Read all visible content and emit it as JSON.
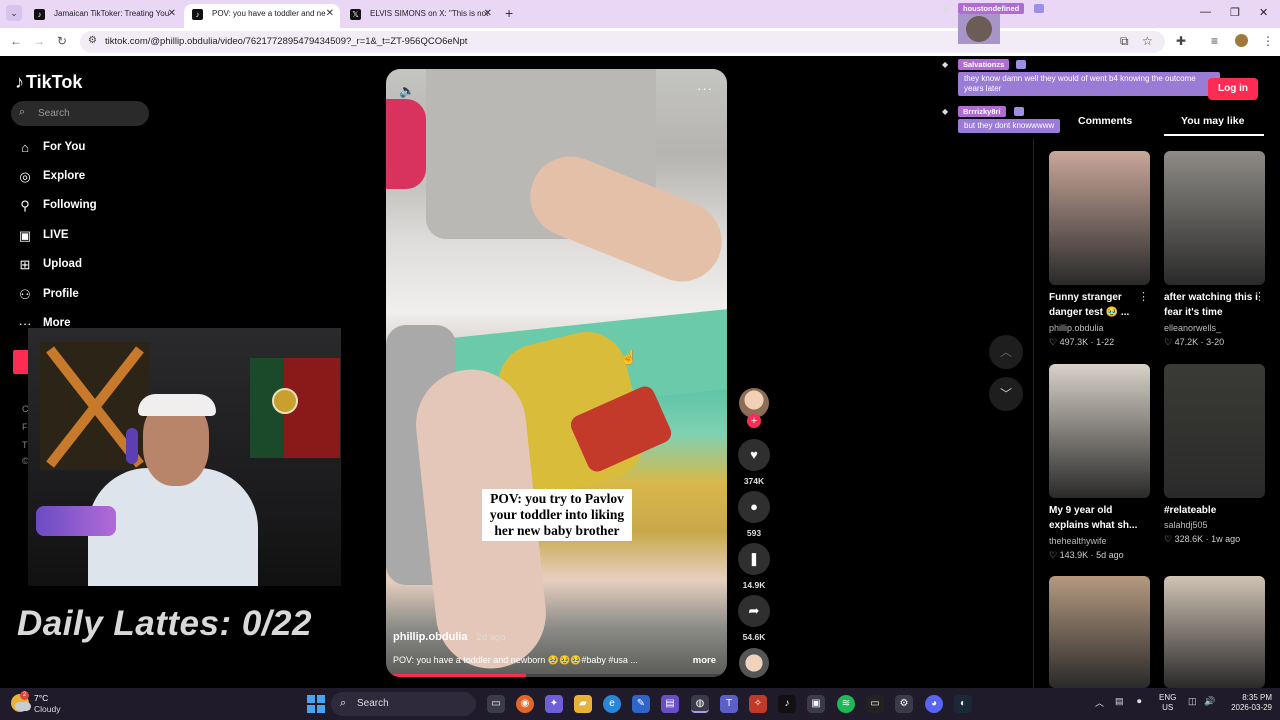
{
  "browser": {
    "tabs": [
      {
        "label": "Jamaican TikToker: Treating You",
        "favicon": "tiktok-icon"
      },
      {
        "label": "POV: you have a toddler and ne",
        "favicon": "tiktok-icon"
      },
      {
        "label": "ELVIS SIMONS on X: \"This is not",
        "favicon": "x-icon"
      }
    ],
    "url": "tiktok.com/@phillip.obdulia/video/7621772895479434509?_r=1&_t=ZT-956QCO6eNpt"
  },
  "tiktok": {
    "logo": "TikTok",
    "search_placeholder": "Search",
    "nav": [
      {
        "label": "For You",
        "icon": "home-icon"
      },
      {
        "label": "Explore",
        "icon": "compass-icon"
      },
      {
        "label": "Following",
        "icon": "user-icon"
      },
      {
        "label": "LIVE",
        "icon": "live-icon"
      },
      {
        "label": "Upload",
        "icon": "plus-square-icon"
      },
      {
        "label": "Profile",
        "icon": "profile-icon"
      },
      {
        "label": "More",
        "icon": "more-icon"
      }
    ],
    "login_label": "Log in",
    "side_tabs": {
      "comments": "Comments",
      "you_may_like": "You may like"
    },
    "video": {
      "caption": "POV: you try to Pavlov your toddler into liking her new baby brother",
      "author": "phillip.obdulia",
      "posted": "· 2d ago",
      "description": "POV: you have a toddler and newborn 🥹🥹🥹#baby #usa ...",
      "more_label": "more",
      "progress": 0.41
    },
    "actions": {
      "likes": "374K",
      "comments": "593",
      "saves": "14.9K",
      "shares": "54.6K"
    },
    "recommendations": [
      {
        "title": "Funny stranger danger test 🥹 ...",
        "author": "phillip.obdulia",
        "likes": "497.3K",
        "date": "1-22",
        "color": "#c9a79a"
      },
      {
        "title": "after watching this i fear it's time",
        "author": "elleanorwells_",
        "likes": "47.2K",
        "date": "3-20",
        "color": "#8e8b86"
      },
      {
        "title": "My 9 year old explains what sh...",
        "author": "thehealthywife",
        "likes": "143.9K",
        "date": "5d ago",
        "color": "#d8d2c8"
      },
      {
        "title": "#relateable",
        "author": "salahdj505",
        "likes": "328.6K",
        "date": "1w ago",
        "color": "#3a3a36"
      },
      {
        "title": "",
        "author": "",
        "likes": "",
        "date": "",
        "color": "#b59a80"
      },
      {
        "title": "",
        "author": "",
        "likes": "",
        "date": "",
        "color": "#cfc3b4"
      }
    ]
  },
  "stream": {
    "daily_lattes": "Daily Lattes: 0/22",
    "chat": [
      {
        "user": "houstondefined",
        "message": ""
      },
      {
        "user": "Salvationzs",
        "message": "they know damn well they would of went b4 knowing the outcome years later"
      },
      {
        "user": "Brrrizky8ri",
        "message": "but they dont knowwwww"
      }
    ]
  },
  "taskbar": {
    "temperature": "7°C",
    "condition": "Cloudy",
    "search_placeholder": "Search",
    "lang_1": "ENG",
    "lang_2": "US",
    "time": "8:35 PM",
    "date": "2026-03-29"
  },
  "colors": {
    "tiktok_accent": "#fe2c55",
    "tab_bar": "#e9d7f5",
    "chat_bubble": "#9a7bd6"
  }
}
